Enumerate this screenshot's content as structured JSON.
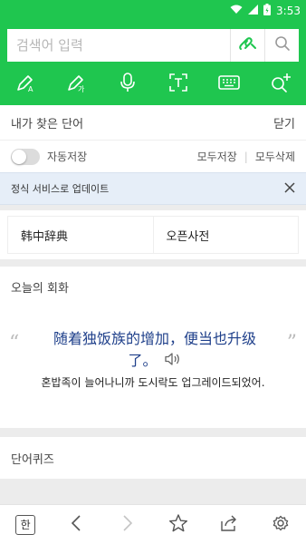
{
  "status": {
    "time": "3:53"
  },
  "search": {
    "placeholder": "검색어 입력"
  },
  "history": {
    "title": "내가 찾은 단어",
    "close_label": "닫기",
    "autosave_label": "자동저장",
    "save_all_label": "모두저장",
    "delete_all_label": "모두삭제"
  },
  "notice": {
    "text": "정식 서비스로 업데이트"
  },
  "dictionaries": [
    {
      "label": "韩中辞典"
    },
    {
      "label": "오픈사전"
    }
  ],
  "today": {
    "title": "오늘의 회화",
    "chinese": "随着独饭族的增加，便当也升级了。",
    "korean": "혼밥족이 늘어나니까 도시락도 업그레이드되었어."
  },
  "quiz": {
    "title": "단어퀴즈"
  },
  "bottom": {
    "lang_label": "한"
  },
  "colors": {
    "brand": "#1fc64f",
    "chinese_text": "#1e3f8a"
  }
}
